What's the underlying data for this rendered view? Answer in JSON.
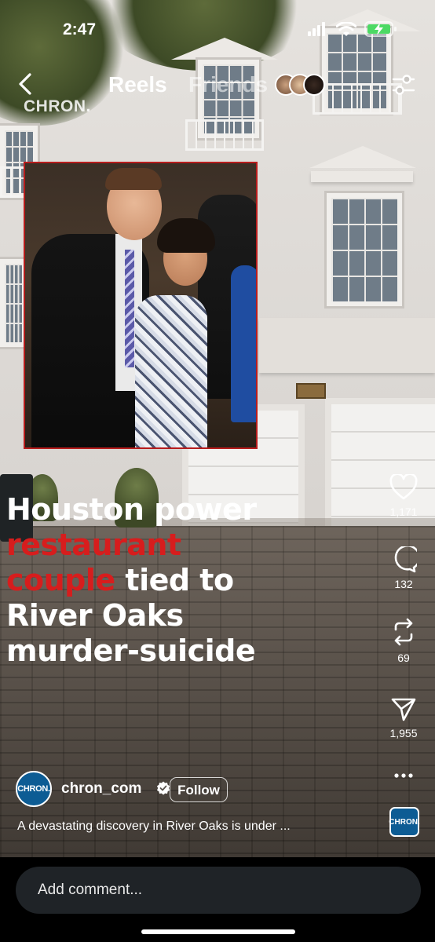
{
  "status_bar": {
    "time": "2:47",
    "signal_icon": "cellular-signal-icon",
    "wifi_icon": "wifi-icon",
    "battery_icon": "battery-charging-icon"
  },
  "header": {
    "back_icon": "chevron-left-icon",
    "tabs": [
      {
        "label": "Reels",
        "active": true
      },
      {
        "label": "Friends",
        "active": false
      }
    ],
    "filter_icon": "sliders-icon"
  },
  "video": {
    "watermark": "CHRON.",
    "headline": {
      "line1": "Houston power",
      "line2_red": "restaurant",
      "line3_red": "couple",
      "line3_white": " tied to",
      "line4": "River Oaks",
      "line5": "murder-suicide"
    },
    "accent_red": "#d71d1d"
  },
  "actions": {
    "like": {
      "icon": "heart-icon",
      "count": "1,171"
    },
    "comment": {
      "icon": "comment-bubble-icon",
      "count": "132"
    },
    "remix": {
      "icon": "repost-icon",
      "count": "69"
    },
    "share": {
      "icon": "paper-plane-icon",
      "count": "1,955"
    },
    "more": {
      "icon": "more-horizontal-icon"
    }
  },
  "author": {
    "avatar_text": "CHRON.",
    "username": "chron_com",
    "verified": true,
    "follow_label": "Follow"
  },
  "caption": "A devastating discovery in River Oaks is under ...",
  "audio_tile_text": "CHRON.",
  "comment_bar": {
    "placeholder": "Add comment..."
  }
}
